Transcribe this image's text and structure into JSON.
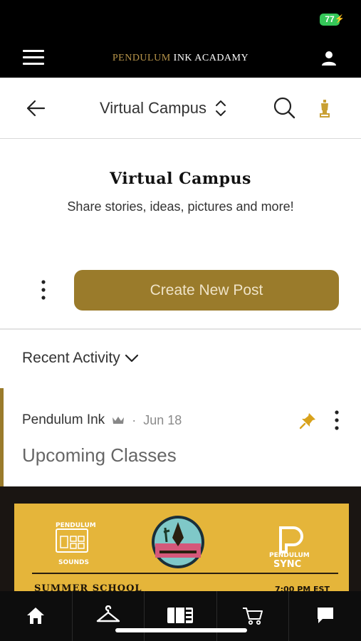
{
  "status_bar": {
    "battery": "77"
  },
  "app_header": {
    "brand_part1": "PENDULUM",
    "brand_part2": " INK ACADAMY",
    "brand_color": "#b8954a"
  },
  "sub_header": {
    "group_name": "Virtual Campus"
  },
  "intro": {
    "title": "Virtual Campus",
    "subtitle": "Share stories, ideas, pictures and more!"
  },
  "actions": {
    "create_post_label": "Create New Post",
    "accent_color": "#9a7b2b"
  },
  "feed": {
    "filter_label": "Recent Activity",
    "posts": [
      {
        "author": "Pendulum Ink",
        "separator": "·",
        "date": "Jun 18",
        "title": "Upcoming Classes",
        "pinned": true,
        "image": {
          "left_logo_top": "PENDULUM",
          "left_logo_bottom": "SOUNDS",
          "right_logo_top": "PENDULUM",
          "right_logo_bottom": "SYNC",
          "heading": "SUMMER SCHOOL",
          "time": "7:00 PM EST"
        }
      }
    ]
  },
  "bottom_nav": {
    "tabs": [
      "home-icon",
      "hanger-icon",
      "film-icon",
      "cart-icon",
      "chat-icon"
    ]
  }
}
